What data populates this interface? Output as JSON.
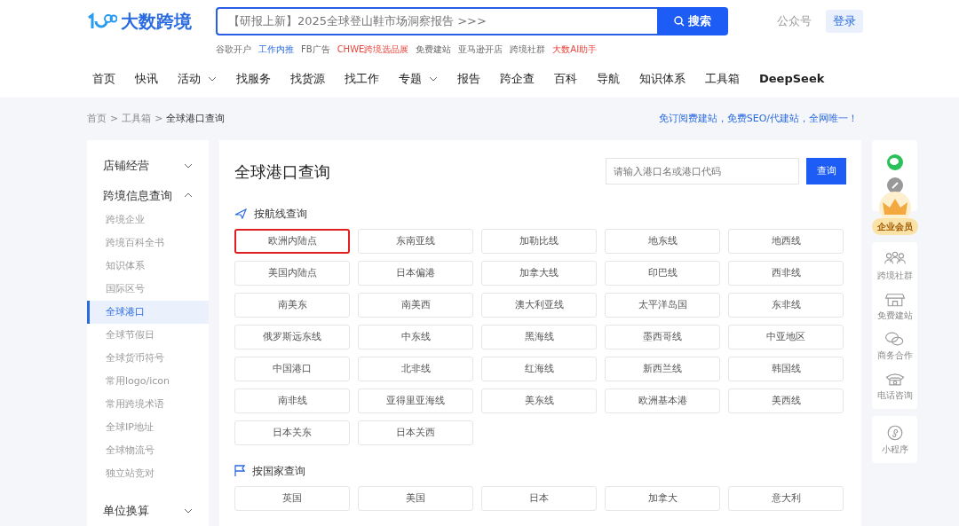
{
  "header": {
    "logo": "大数跨境",
    "search": {
      "placeholder": "【研报上新】2025全球登山鞋市场洞察报告 >>>",
      "button": "搜索"
    },
    "links": [
      {
        "label": "公众号",
        "kind": "plain"
      },
      {
        "label": "登录",
        "kind": "pill"
      }
    ],
    "quick_links": [
      {
        "label": "谷歌开户",
        "kind": "normal"
      },
      {
        "label": "工作内推",
        "kind": "featured"
      },
      {
        "label": "FB广告",
        "kind": "normal"
      },
      {
        "label": "CHWE跨境选品展",
        "kind": "hot"
      },
      {
        "label": "免费建站",
        "kind": "normal"
      },
      {
        "label": "亚马逊开店",
        "kind": "normal"
      },
      {
        "label": "跨境社群",
        "kind": "normal"
      },
      {
        "label": "大数AI助手",
        "kind": "hot"
      }
    ],
    "nav": [
      {
        "label": "首页",
        "dropdown": false
      },
      {
        "label": "快讯",
        "dropdown": false
      },
      {
        "label": "活动",
        "dropdown": true
      },
      {
        "label": "找服务",
        "dropdown": false
      },
      {
        "label": "找货源",
        "dropdown": false
      },
      {
        "label": "找工作",
        "dropdown": false
      },
      {
        "label": "专题",
        "dropdown": true
      },
      {
        "label": "报告",
        "dropdown": false
      },
      {
        "label": "跨企查",
        "dropdown": false
      },
      {
        "label": "百科",
        "dropdown": false
      },
      {
        "label": "导航",
        "dropdown": false
      },
      {
        "label": "知识体系",
        "dropdown": false
      },
      {
        "label": "工具箱",
        "dropdown": false
      },
      {
        "label": "DeepSeek",
        "dropdown": false
      }
    ]
  },
  "breadcrumb": [
    {
      "label": "首页",
      "separator": ">"
    },
    {
      "label": "工具箱",
      "separator": ">"
    },
    {
      "label": "全球港口查询"
    }
  ],
  "promo": "免订阅费建站，免费SEO/代建站，全网唯一！",
  "sidebar": [
    {
      "label": "店铺经营",
      "expanded": false
    },
    {
      "label": "跨境信息查询",
      "expanded": true,
      "children": [
        {
          "label": "跨境企业",
          "selected": false
        },
        {
          "label": "跨境百科全书",
          "selected": false
        },
        {
          "label": "知识体系",
          "selected": false
        },
        {
          "label": "国际区号",
          "selected": false
        },
        {
          "label": "全球港口",
          "selected": true
        },
        {
          "label": "全球节假日",
          "selected": false
        },
        {
          "label": "全球货币符号",
          "selected": false
        },
        {
          "label": "常用logo/icon",
          "selected": false
        },
        {
          "label": "常用跨境术语",
          "selected": false
        },
        {
          "label": "全球IP地址",
          "selected": false
        },
        {
          "label": "全球物流号",
          "selected": false
        },
        {
          "label": "独立站竞对",
          "selected": false
        }
      ]
    },
    {
      "label": "单位换算",
      "expanded": false
    }
  ],
  "main": {
    "title": "全球港口查询",
    "search": {
      "placeholder": "请输入港口名或港口代码",
      "button": "查询"
    },
    "sections": [
      {
        "kind": "route",
        "heading": "按航线查询",
        "items": [
          {
            "label": "欧洲内陆点",
            "selected": true
          },
          {
            "label": "东南亚线",
            "selected": false
          },
          {
            "label": "加勒比线",
            "selected": false
          },
          {
            "label": "地东线",
            "selected": false
          },
          {
            "label": "地西线",
            "selected": false
          },
          {
            "label": "美国内陆点",
            "selected": false
          },
          {
            "label": "日本偏港",
            "selected": false
          },
          {
            "label": "加拿大线",
            "selected": false
          },
          {
            "label": "印巴线",
            "selected": false
          },
          {
            "label": "西非线",
            "selected": false
          },
          {
            "label": "南美东",
            "selected": false
          },
          {
            "label": "南美西",
            "selected": false
          },
          {
            "label": "澳大利亚线",
            "selected": false
          },
          {
            "label": "太平洋岛国",
            "selected": false
          },
          {
            "label": "东非线",
            "selected": false
          },
          {
            "label": "俄罗斯远东线",
            "selected": false
          },
          {
            "label": "中东线",
            "selected": false
          },
          {
            "label": "黑海线",
            "selected": false
          },
          {
            "label": "墨西哥线",
            "selected": false
          },
          {
            "label": "中亚地区",
            "selected": false
          },
          {
            "label": "中国港口",
            "selected": false
          },
          {
            "label": "北非线",
            "selected": false
          },
          {
            "label": "红海线",
            "selected": false
          },
          {
            "label": "新西兰线",
            "selected": false
          },
          {
            "label": "韩国线",
            "selected": false
          },
          {
            "label": "南非线",
            "selected": false
          },
          {
            "label": "亚得里亚海线",
            "selected": false
          },
          {
            "label": "美东线",
            "selected": false
          },
          {
            "label": "欧洲基本港",
            "selected": false
          },
          {
            "label": "美西线",
            "selected": false
          },
          {
            "label": "日本关东",
            "selected": false
          },
          {
            "label": "日本关西",
            "selected": false
          }
        ]
      },
      {
        "kind": "country",
        "heading": "按国家查询",
        "items": [
          {
            "label": "英国",
            "selected": false
          },
          {
            "label": "美国",
            "selected": false
          },
          {
            "label": "日本",
            "selected": false
          },
          {
            "label": "加拿大",
            "selected": false
          },
          {
            "label": "意大利",
            "selected": false
          }
        ]
      }
    ]
  },
  "rail": {
    "badge": "企业会员",
    "items": [
      {
        "kind": "group",
        "label": "跨境社群"
      },
      {
        "kind": "shop",
        "label": "免费建站"
      },
      {
        "kind": "chat",
        "label": "商务合作"
      },
      {
        "kind": "phone",
        "label": "电话咨询"
      },
      {
        "kind": "mini",
        "label": "小程序"
      }
    ]
  }
}
